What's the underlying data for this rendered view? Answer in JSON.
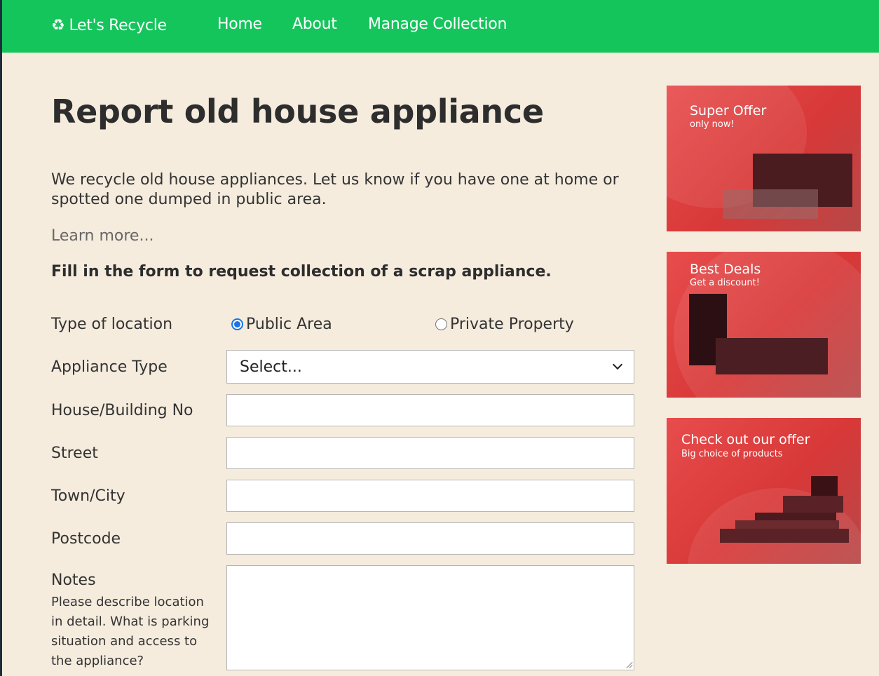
{
  "nav": {
    "brand": "Let's Recycle",
    "brand_icon": "♻",
    "links": [
      "Home",
      "About",
      "Manage Collection"
    ]
  },
  "page": {
    "title": "Report old house appliance",
    "intro": "We recycle old house appliances. Let us know if you have one at home or spotted one dumped in public area.",
    "learn_more": "Learn more...",
    "form_heading": "Fill in the form to request collection of a scrap appliance."
  },
  "form": {
    "location_label": "Type of location",
    "location_options": [
      "Public Area",
      "Private Property"
    ],
    "location_selected": "Public Area",
    "appliance_label": "Appliance Type",
    "appliance_value": "Select...",
    "house_label": "House/Building No",
    "house_value": "",
    "street_label": "Street",
    "street_value": "",
    "town_label": "Town/City",
    "town_value": "",
    "postcode_label": "Postcode",
    "postcode_value": "",
    "notes_label": "Notes",
    "notes_help": "Please describe location in detail. What is parking situation and access to the appliance?",
    "notes_value": ""
  },
  "ads": [
    {
      "title": "Super Offer",
      "sub": "only now!"
    },
    {
      "title": "Best Deals",
      "sub": "Get a discount!"
    },
    {
      "title": "Check out our offer",
      "sub": "Big choice of products"
    }
  ],
  "colors": {
    "navbar": "#14c55c",
    "background": "#f5ecde",
    "ad_red": "#e04444",
    "radio_accent": "#1a73e8"
  }
}
